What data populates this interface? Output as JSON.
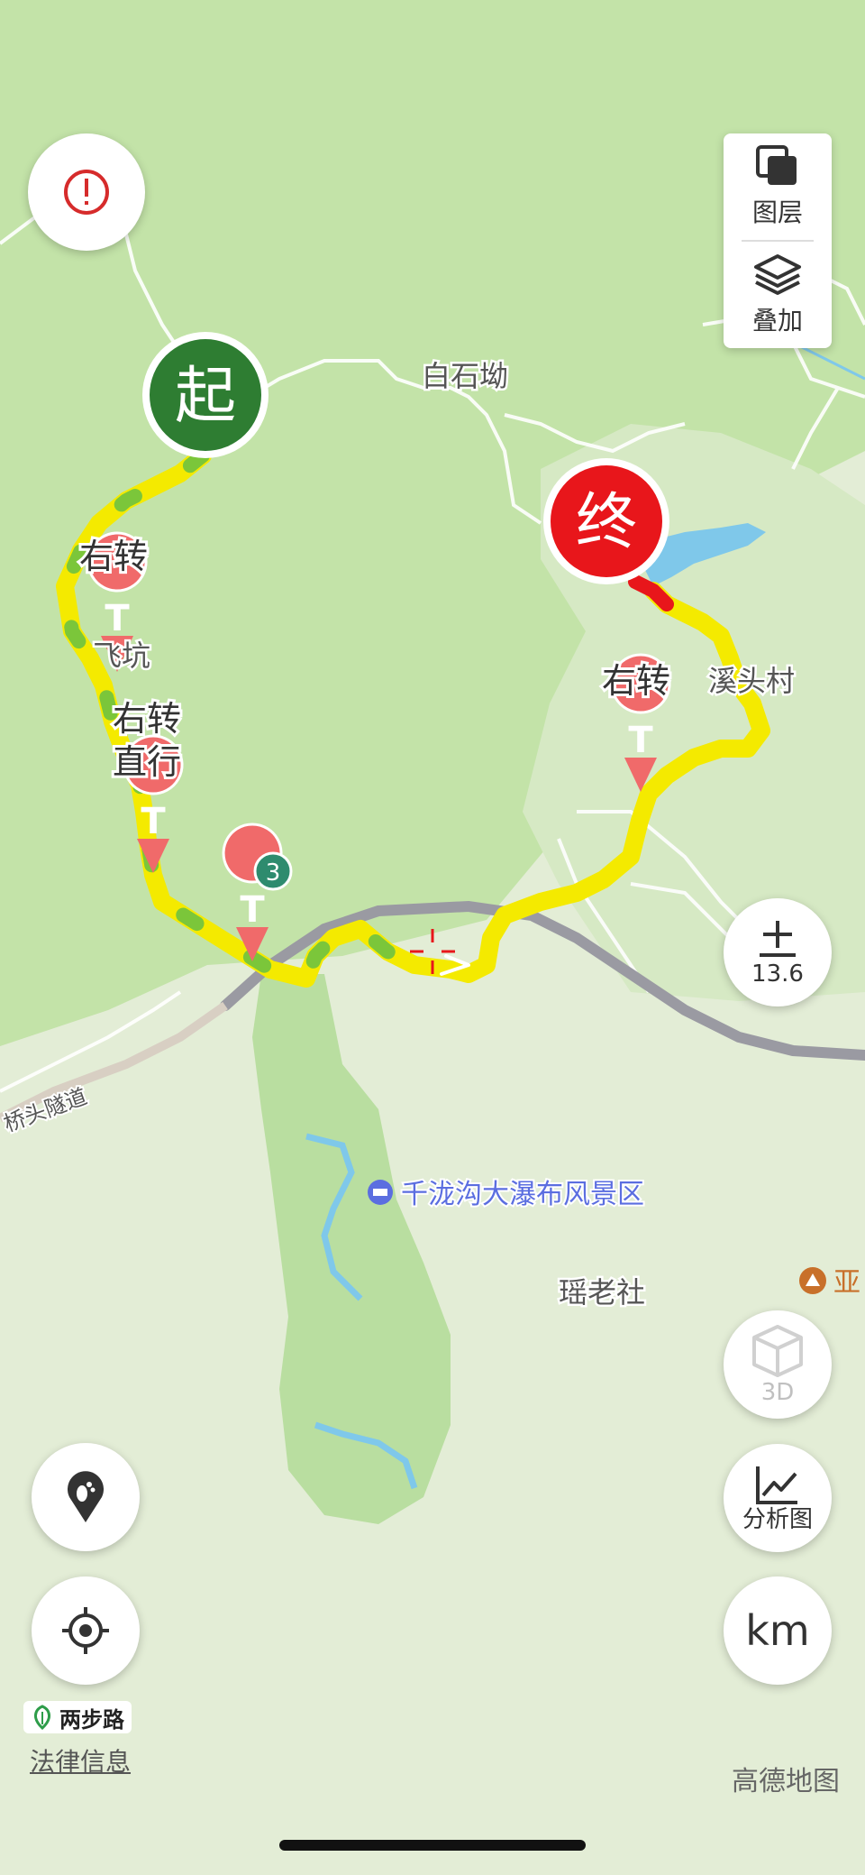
{
  "map": {
    "place_labels": {
      "baishi": "白石坳",
      "feikeng": "飞坑",
      "xitou": "溪头村",
      "qiaotou_tunnel": "桥头隧道",
      "scenic_area": "千泷沟大瀑布风景区",
      "yaolaoshe": "瑶老社",
      "partial_poi": "亚"
    },
    "route_markers": {
      "start": "起",
      "end": "终"
    },
    "instructions": {
      "turn_right_1": "右转",
      "turn_right_2": "右转",
      "go_straight": "直行",
      "turn_right_3": "右转"
    },
    "waypoint_glyph": "T",
    "waypoint_badge": "3",
    "colors": {
      "start": "#2e7d32",
      "end": "#e8161b",
      "route_yellow": "#f4ea00",
      "route_green": "#7bc63a",
      "waypoint": "#f06a6a",
      "water": "#7fc8ea",
      "road": "#9a9aa2",
      "scenic_poi": "#5b6ee0"
    }
  },
  "controls": {
    "alert_icon": "alert-circle-icon",
    "layers_label": "图层",
    "overlay_label": "叠加",
    "zoom_level": "13.6",
    "threed_label": "3D",
    "analysis_label": "分析图",
    "unit_label": "km",
    "footprint_icon": "footprint-pin-icon",
    "locate_icon": "crosshair-locate-icon"
  },
  "footer": {
    "brand": "两步路",
    "legal": "法律信息",
    "map_provider": "高德地图"
  }
}
